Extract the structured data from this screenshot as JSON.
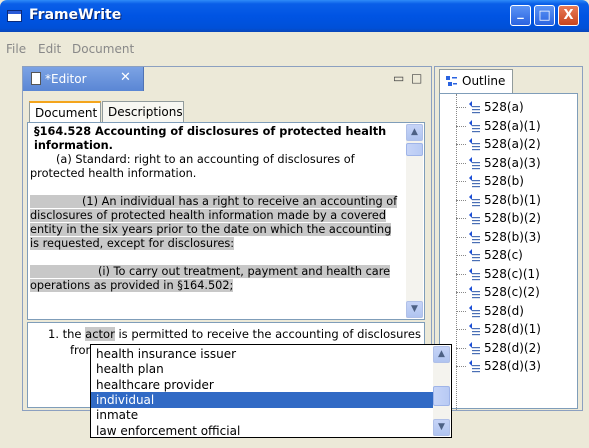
{
  "window": {
    "title": "FrameWrite",
    "minimize": "_",
    "maximize": "□",
    "close": "X"
  },
  "menu": [
    "File",
    "Edit",
    "Document"
  ],
  "editor": {
    "tab_label": "*Editor",
    "tab_close": "✕",
    "minimize": "▭",
    "maximize": "□",
    "subtabs": [
      "Document",
      "Descriptions"
    ],
    "heading": "§164.528 Accounting of disclosures of protected health information.",
    "para_a": "(a) Standard: right to an accounting of disclosures of protected health information.",
    "para_1": "(1) An individual has a right to receive an accounting of disclosures of protected health information made by a covered entity in the six years prior to the date on which the accounting is requested, except for disclosures:",
    "para_i": "(i) To carry out treatment, payment and health care operations as provided in §164.502;"
  },
  "rule": {
    "prefix": "1. the",
    "selected_word": "actor",
    "suffix": "is permitted to receive the accounting of disclosures",
    "from": "from"
  },
  "dropdown": {
    "items": [
      "health insurance issuer",
      "health plan",
      "healthcare provider",
      "individual",
      "inmate",
      "law enforcement official"
    ],
    "selected": "individual"
  },
  "outline": {
    "tab_label": "Outline",
    "items": [
      "528(a)",
      "528(a)(1)",
      "528(a)(2)",
      "528(a)(3)",
      "528(b)",
      "528(b)(1)",
      "528(b)(2)",
      "528(b)(3)",
      "528(c)",
      "528(c)(1)",
      "528(c)(2)",
      "528(d)",
      "528(d)(1)",
      "528(d)(2)",
      "528(d)(3)"
    ]
  },
  "colors": {
    "titlebar": "#0054E3",
    "selection": "#316AC5",
    "highlight": "#C8C8C8",
    "active_tab_accent": "#F4A51C"
  }
}
